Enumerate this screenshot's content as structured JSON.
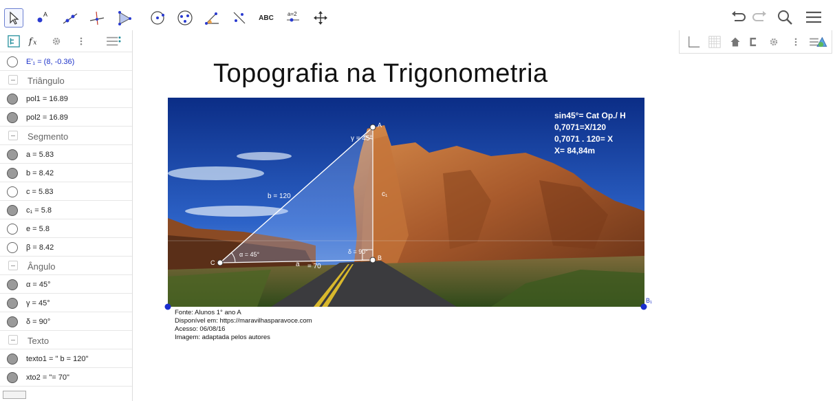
{
  "toolbar": {
    "text_tool_label": "ABC",
    "slider_tool_label": "a=2"
  },
  "algebra": {
    "items": [
      {
        "type": "item",
        "value": "E'₁ = (8, -0.36)",
        "filled": false,
        "blue": true
      },
      {
        "type": "group",
        "value": "Triângulo"
      },
      {
        "type": "item",
        "value": "pol1 = 16.89",
        "filled": true
      },
      {
        "type": "item",
        "value": "pol2 = 16.89",
        "filled": true
      },
      {
        "type": "group",
        "value": "Segmento"
      },
      {
        "type": "item",
        "value": "a = 5.83",
        "filled": true
      },
      {
        "type": "item",
        "value": "b = 8.42",
        "filled": true
      },
      {
        "type": "item",
        "value": "c = 5.83",
        "filled": false
      },
      {
        "type": "item",
        "value": "c₁ = 5.8",
        "filled": true
      },
      {
        "type": "item",
        "value": "e = 5.8",
        "filled": false
      },
      {
        "type": "item",
        "value": "β = 8.42",
        "filled": false
      },
      {
        "type": "group",
        "value": "Ângulo"
      },
      {
        "type": "item",
        "value": "α = 45°",
        "filled": true
      },
      {
        "type": "item",
        "value": "γ = 45°",
        "filled": true
      },
      {
        "type": "item",
        "value": "δ = 90°",
        "filled": true
      },
      {
        "type": "group",
        "value": "Texto"
      },
      {
        "type": "item",
        "value": "texto1 = \" b = 120\"",
        "filled": true
      },
      {
        "type": "item",
        "value": "xto2 = \"= 70\"",
        "filled": true
      }
    ]
  },
  "graphics": {
    "title": "Topografia na Trigonometria",
    "photo_labels": {
      "A": "A",
      "B": "B",
      "C": "C",
      "B1": "B₁",
      "gamma": "γ = 45°",
      "alpha": "α = 45°",
      "delta": "δ = 90°",
      "b_len": "b = 120",
      "c1": "c₁",
      "a": "a",
      "a_len": "= 70"
    },
    "formula": [
      "sin45°= Cat Op./ H",
      "0,7071=X/120",
      "0,7071 . 120= X",
      "X= 84,84m"
    ],
    "caption": [
      "Fonte: Alunos 1° ano A",
      "Disponível em: https://maravilhasparavoce.com",
      "Acesso: 06/08/16",
      "Imagem: adaptada pelos autores"
    ]
  }
}
